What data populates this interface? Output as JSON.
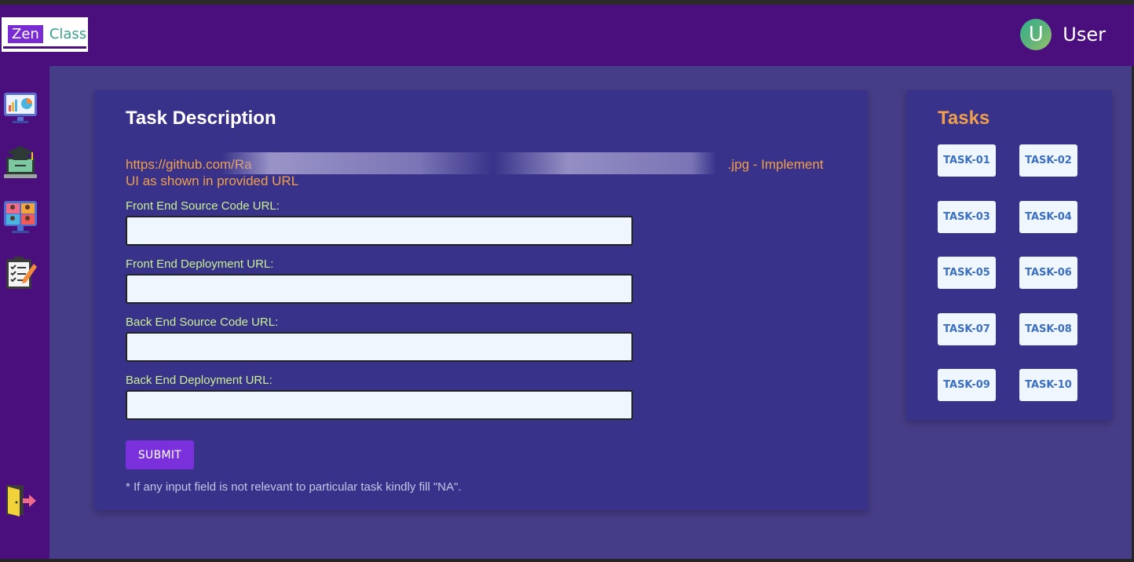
{
  "header": {
    "logo_part1": "Zen",
    "logo_part2": "Class",
    "avatar_letter": "U",
    "user_name": "User"
  },
  "sidebar": {
    "icons": [
      "dashboard-chart-icon",
      "graduation-laptop-icon",
      "video-class-icon",
      "task-clipboard-icon",
      "logout-door-icon"
    ]
  },
  "task": {
    "title": "Task Description",
    "description_prefix": "https://github.com/Ra",
    "description_suffix": ".jpg - Implement UI as shown in provided URL",
    "fields": [
      {
        "label": "Front End Source Code URL:",
        "value": ""
      },
      {
        "label": "Front End Deployment URL:",
        "value": ""
      },
      {
        "label": "Back End Source Code URL:",
        "value": ""
      },
      {
        "label": "Back End Deployment URL:",
        "value": ""
      }
    ],
    "submit_label": "SUBMIT",
    "note": "* If any input field is not relevant to particular task kindly fill \"NA\"."
  },
  "tasks_panel": {
    "title": "Tasks",
    "items": [
      "TASK-01",
      "TASK-02",
      "TASK-03",
      "TASK-04",
      "TASK-05",
      "TASK-06",
      "TASK-07",
      "TASK-08",
      "TASK-09",
      "TASK-10"
    ]
  },
  "colors": {
    "header_bg": "#4a0f7d",
    "main_bg": "#463d88",
    "card_bg": "#38328a",
    "accent_orange": "#f0a04a",
    "label_green": "#c9f28e",
    "submit_purple": "#7a31dc",
    "task_text_blue": "#3b6fc0"
  }
}
